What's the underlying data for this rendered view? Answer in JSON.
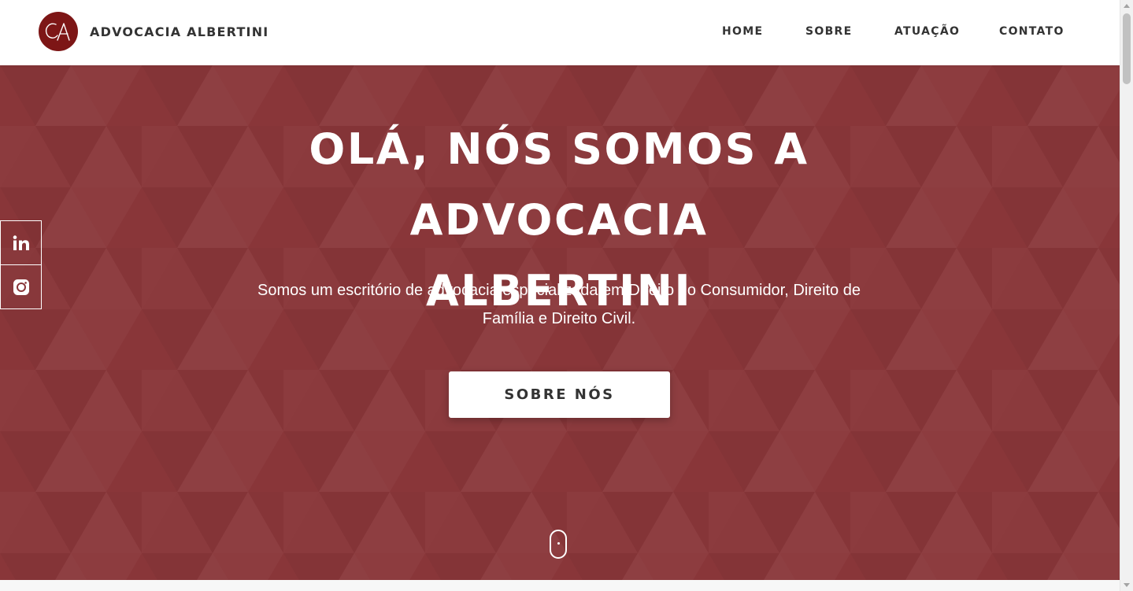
{
  "header": {
    "brand_name": "ADVOCACIA ALBERTINI",
    "logo_icon": "ca-monogram-logo",
    "nav": {
      "home": "HOME",
      "sobre": "SOBRE",
      "atuacao": "ATUAÇÃO",
      "contato": "CONTATO"
    }
  },
  "hero": {
    "title_line1": "OLÁ, NÓS SOMOS A ADVOCACIA",
    "title_line2": "ALBERTINI",
    "subtitle_line1": "Somos um escritório de advocacia especializada em Direito do Consumidor, Direito de",
    "subtitle_line2": "Família e Direito Civil.",
    "button_label": "SOBRE NÓS",
    "scroll_icon": "mouse-scroll-icon"
  },
  "social": {
    "items": [
      {
        "icon": "linkedin-icon"
      },
      {
        "icon": "instagram-icon"
      }
    ]
  },
  "colors": {
    "hero_background": "#893639",
    "logo_background": "#7d1616",
    "header_background": "#ffffff",
    "text_dark": "#333333"
  }
}
